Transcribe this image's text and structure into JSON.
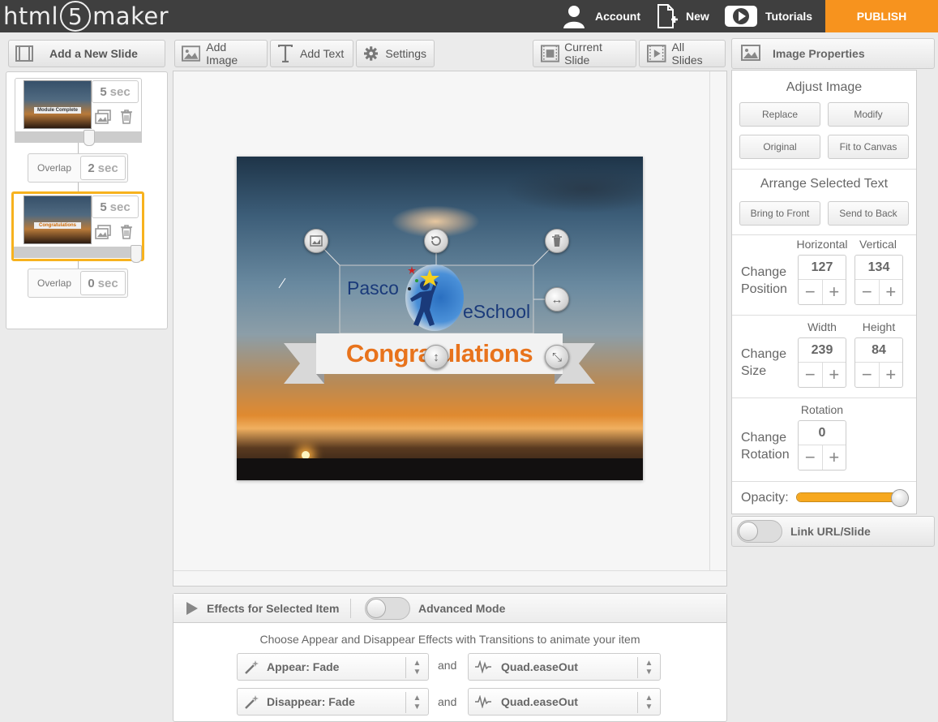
{
  "app": {
    "logo_pre": "html",
    "logo_num": "5",
    "logo_post": "maker"
  },
  "topnav": {
    "account": "Account",
    "new": "New",
    "tutorials": "Tutorials",
    "publish": "PUBLISH"
  },
  "toolbar": {
    "add_slide": "Add a New Slide",
    "add_image": "Add Image",
    "add_text": "Add Text",
    "settings": "Settings",
    "current_slide": "Current Slide",
    "all_slides": "All Slides",
    "image_properties": "Image Properties"
  },
  "slides": [
    {
      "duration": "5",
      "unit": "sec",
      "thumb_text": "Module Complete",
      "overlap_label": "Overlap",
      "overlap": "2"
    },
    {
      "duration": "5",
      "unit": "sec",
      "thumb_text": "Congratulations",
      "overlap_label": "Overlap",
      "overlap": "0"
    }
  ],
  "canvas": {
    "logo_left": "Pasco",
    "logo_right": "eSchool",
    "banner": "Congratulations"
  },
  "props": {
    "adjust_title": "Adjust Image",
    "replace": "Replace",
    "modify": "Modify",
    "original": "Original",
    "fit": "Fit to Canvas",
    "arrange_title": "Arrange Selected Text",
    "front": "Bring to Front",
    "back": "Send to Back",
    "position_label1": "Change",
    "position_label2": "Position",
    "horizontal": "Horizontal",
    "vertical": "Vertical",
    "pos_x": "127",
    "pos_y": "134",
    "size_label1": "Change",
    "size_label2": "Size",
    "width": "Width",
    "height": "Height",
    "w": "239",
    "h": "84",
    "rot_label1": "Change",
    "rot_label2": "Rotation",
    "rotation": "Rotation",
    "rot": "0",
    "opacity": "Opacity:",
    "opacity_value": 1.0,
    "link": "Link URL/Slide"
  },
  "effects": {
    "title": "Effects for Selected Item",
    "advanced": "Advanced Mode",
    "instruction": "Choose Appear and Disappear Effects with Transitions to animate your item",
    "appear": "Appear: Fade",
    "disappear": "Disappear: Fade",
    "and": "and",
    "ease1": "Quad.easeOut",
    "ease2": "Quad.easeOut"
  },
  "colors": {
    "accent": "#f7931e",
    "topbar": "#3f3f3f",
    "banner_text": "#e8731c",
    "logo_blue": "#1a3a7a"
  }
}
